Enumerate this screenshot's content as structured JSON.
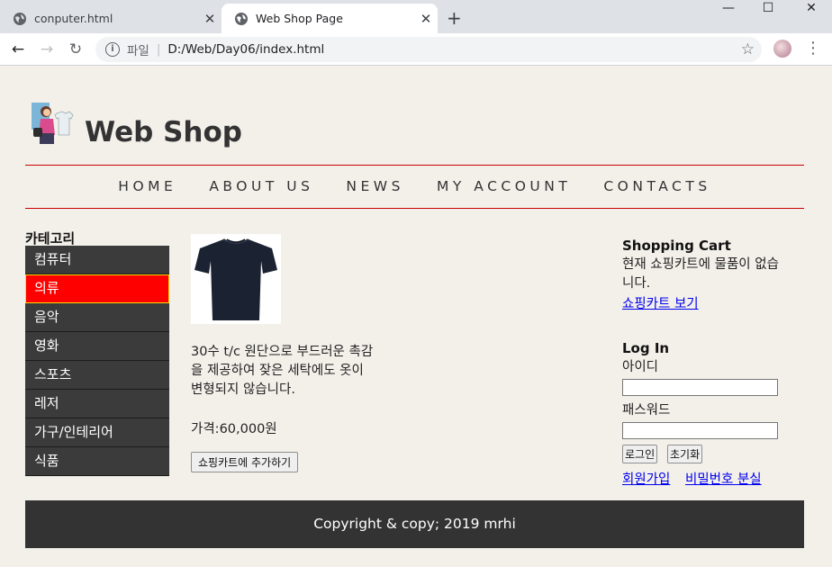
{
  "browser": {
    "tabs": [
      {
        "title": "conputer.html",
        "active": false
      },
      {
        "title": "Web Shop Page",
        "active": true
      }
    ],
    "address": {
      "scheme_label": "파일",
      "url": "D:/Web/Day06/index.html"
    }
  },
  "site": {
    "title": "Web Shop",
    "nav": [
      "HOME",
      "ABOUT US",
      "NEWS",
      "MY ACCOUNT",
      "CONTACTS"
    ]
  },
  "category": {
    "heading": "카테고리",
    "items": [
      "컴퓨터",
      "의류",
      "음악",
      "영화",
      "스포츠",
      "레저",
      "가구/인테리어",
      "식품"
    ],
    "active_index": 1
  },
  "product": {
    "image_icon": "tshirt-image",
    "description": "30수 t/c 원단으로 부드러운 촉감을 제공하여 잦은 세탁에도 옷이 변형되지 않습니다.",
    "price": "가격:60,000원",
    "add_to_cart_label": "쇼핑카트에 추가하기"
  },
  "cart": {
    "title": "Shopping Cart",
    "status": "현재 쇼핑카트에 물품이 없습니다.",
    "view_link": "쇼핑카트 보기"
  },
  "login": {
    "title": "Log In",
    "id_label": "아이디",
    "password_label": "패스워드",
    "login_button": "로그인",
    "reset_button": "초기화",
    "signup_link": "회원가입",
    "find_password_link": "비밀번호 분실"
  },
  "footer": {
    "text": "Copyright & copy; 2019 mrhi"
  },
  "colors": {
    "accent_red": "#ff0000",
    "rule_red": "#c80000",
    "menu_dark": "#3b3b3b",
    "page_bg": "#f3f0ea",
    "footer_bg": "#333333"
  }
}
